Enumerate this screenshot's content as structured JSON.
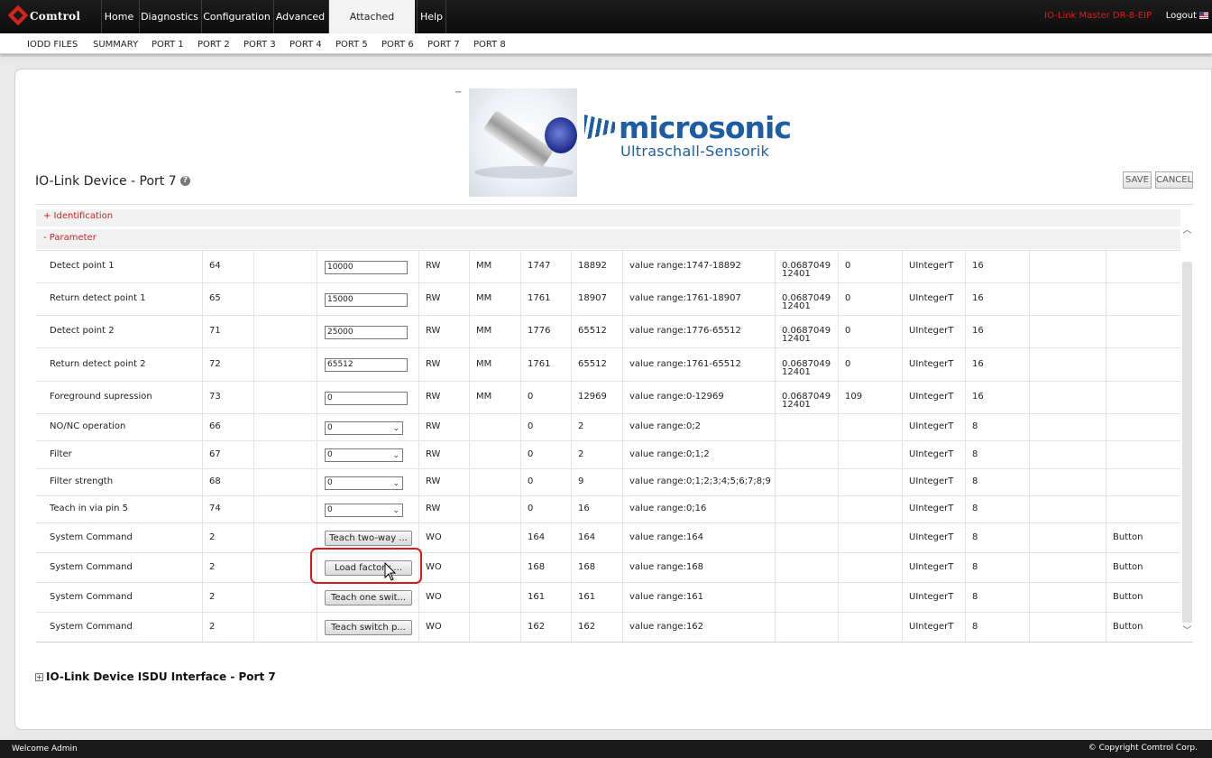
{
  "brand": {
    "logo_text": "Comtrol"
  },
  "nav": {
    "items": [
      "Home",
      "Diagnostics",
      "Configuration",
      "Advanced",
      "Attached Devices",
      "Help"
    ],
    "active": "Attached Devices",
    "master_label": "IO-Link Master DR-8-EIP",
    "logout": "Logout"
  },
  "subnav": {
    "items": [
      "IODD FILES",
      "SUMMARY",
      "PORT 1",
      "PORT 2",
      "PORT 3",
      "PORT 4",
      "PORT 5",
      "PORT 6",
      "PORT 7",
      "PORT 8"
    ]
  },
  "header": {
    "collapse_symbol": "−",
    "title": "IO-Link Device - Port 7",
    "help_symbol": "?",
    "save_label": "SAVE",
    "cancel_label": "CANCEL"
  },
  "vendor": {
    "name": "microsonic",
    "subtitle": "Ultraschall-Sensorik"
  },
  "sections": {
    "identification": "+ Identification",
    "parameter": "- Parameter"
  },
  "rows": [
    {
      "name": "Detect point 1",
      "index": "64",
      "control": "input",
      "value": "10000",
      "access": "RW",
      "unit": "MM",
      "min": "1747",
      "max": "18892",
      "range": "value range:1747-18892",
      "grad": "0.0687049\n12401",
      "offset": "0",
      "type": "UIntegerT",
      "bits": "16",
      "extra": ""
    },
    {
      "name": "Return detect point 1",
      "index": "65",
      "control": "input",
      "value": "15000",
      "access": "RW",
      "unit": "MM",
      "min": "1761",
      "max": "18907",
      "range": "value range:1761-18907",
      "grad": "0.0687049\n12401",
      "offset": "0",
      "type": "UIntegerT",
      "bits": "16",
      "extra": ""
    },
    {
      "name": "Detect point 2",
      "index": "71",
      "control": "input",
      "value": "25000",
      "access": "RW",
      "unit": "MM",
      "min": "1776",
      "max": "65512",
      "range": "value range:1776-65512",
      "grad": "0.0687049\n12401",
      "offset": "0",
      "type": "UIntegerT",
      "bits": "16",
      "extra": ""
    },
    {
      "name": "Return detect point 2",
      "index": "72",
      "control": "input",
      "value": "65512",
      "access": "RW",
      "unit": "MM",
      "min": "1761",
      "max": "65512",
      "range": "value range:1761-65512",
      "grad": "0.0687049\n12401",
      "offset": "0",
      "type": "UIntegerT",
      "bits": "16",
      "extra": ""
    },
    {
      "name": "Foreground supression",
      "index": "73",
      "control": "input",
      "value": "0",
      "access": "RW",
      "unit": "MM",
      "min": "0",
      "max": "12969",
      "range": "value range:0-12969",
      "grad": "0.0687049\n12401",
      "offset": "109",
      "type": "UIntegerT",
      "bits": "16",
      "extra": ""
    },
    {
      "name": "NO/NC operation",
      "index": "66",
      "control": "select",
      "value": "0",
      "access": "RW",
      "unit": "",
      "min": "0",
      "max": "2",
      "range": "value range:0;2",
      "grad": "",
      "offset": "",
      "type": "UIntegerT",
      "bits": "8",
      "extra": ""
    },
    {
      "name": "Filter",
      "index": "67",
      "control": "select",
      "value": "0",
      "access": "RW",
      "unit": "",
      "min": "0",
      "max": "2",
      "range": "value range:0;1;2",
      "grad": "",
      "offset": "",
      "type": "UIntegerT",
      "bits": "8",
      "extra": ""
    },
    {
      "name": "Filter strength",
      "index": "68",
      "control": "select",
      "value": "0",
      "access": "RW",
      "unit": "",
      "min": "0",
      "max": "9",
      "range": "value range:0;1;2;3;4;5;6;7;8;9",
      "grad": "",
      "offset": "",
      "type": "UIntegerT",
      "bits": "8",
      "extra": ""
    },
    {
      "name": "Teach in via pin 5",
      "index": "74",
      "control": "select",
      "value": "0",
      "access": "RW",
      "unit": "",
      "min": "0",
      "max": "16",
      "range": "value range:0;16",
      "grad": "",
      "offset": "",
      "type": "UIntegerT",
      "bits": "8",
      "extra": ""
    },
    {
      "name": "System Command",
      "index": "2",
      "control": "button",
      "value": "Teach two-way ...",
      "access": "WO",
      "unit": "",
      "min": "164",
      "max": "164",
      "range": "value range:164",
      "grad": "",
      "offset": "",
      "type": "UIntegerT",
      "bits": "8",
      "extra": "Button"
    },
    {
      "name": "System Command",
      "index": "2",
      "control": "button",
      "value": "Load factory ...",
      "access": "WO",
      "unit": "",
      "min": "168",
      "max": "168",
      "range": "value range:168",
      "grad": "",
      "offset": "",
      "type": "UIntegerT",
      "bits": "8",
      "extra": "Button"
    },
    {
      "name": "System Command",
      "index": "2",
      "control": "button",
      "value": "Teach one swit...",
      "access": "WO",
      "unit": "",
      "min": "161",
      "max": "161",
      "range": "value range:161",
      "grad": "",
      "offset": "",
      "type": "UIntegerT",
      "bits": "8",
      "extra": "Button"
    },
    {
      "name": "System Command",
      "index": "2",
      "control": "button",
      "value": "Teach switch p...",
      "access": "WO",
      "unit": "",
      "min": "162",
      "max": "162",
      "range": "value range:162",
      "grad": "",
      "offset": "",
      "type": "UIntegerT",
      "bits": "8",
      "extra": "Button"
    }
  ],
  "isdu": {
    "expand_symbol": "+",
    "title": "IO-Link Device ISDU Interface - Port 7"
  },
  "footer": {
    "welcome": "Welcome Admin",
    "copyright": "© Copyright Comtrol Corp."
  },
  "colors": {
    "accent_red": "#d61919",
    "link_red": "#cc2222",
    "brand_blue": "#1d5da6"
  },
  "icons": {
    "help": "help-icon",
    "cursor": "cursor-icon",
    "flag": "us-flag-icon"
  }
}
